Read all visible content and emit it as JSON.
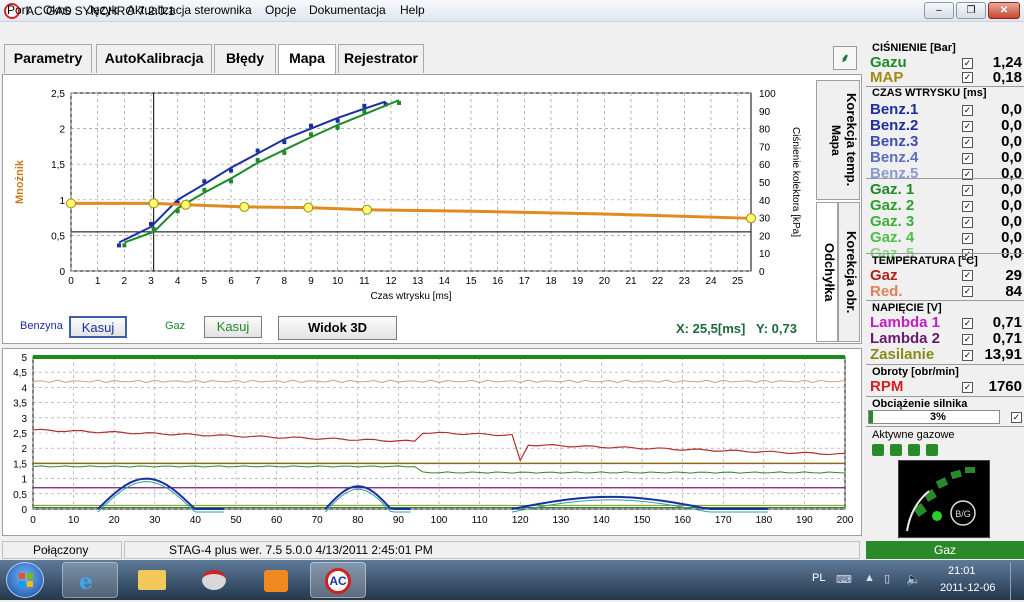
{
  "window": {
    "title": "AC GAS SYNCHRO  7.2.0.1"
  },
  "menu": [
    "Port",
    "Okno",
    "Język",
    "Aktualizacja sterownika",
    "Opcje",
    "Dokumentacja",
    "Help"
  ],
  "tabs": [
    "Parametry",
    "AutoKalibracja",
    "Błędy",
    "Mapa",
    "Rejestrator"
  ],
  "side_tabs": {
    "mapa": "Mapa",
    "korekcja_temp": "Korekcja temp.",
    "odchylka": "Odchyłka",
    "korekcja_obr": "Korekcja obr."
  },
  "map_controls": {
    "benzyna_label": "Benzyna",
    "kasuj": "Kasuj",
    "gaz_label": "Gaz",
    "widok3d": "Widok 3D",
    "coord_x": "X: 25,5[ms]",
    "coord_y": "Y: 0,73"
  },
  "colors": {
    "benzyna": "#1c2fa0",
    "gaz": "#1f8a2a",
    "multiplier": "#e08a20",
    "petrol_line": "#b03030",
    "status_ok": "#2a8a2a"
  },
  "chart_data": [
    {
      "type": "line",
      "xlabel": "Czas wtrysku [ms]",
      "ylabel": "Mnożnik",
      "y2label": "Ciśnienie kolektora [kPa]",
      "xlim": [
        0,
        25.5
      ],
      "ylim": [
        0,
        2.5
      ],
      "y2lim": [
        0,
        100
      ],
      "x_ticks": [
        0,
        1,
        2,
        3,
        4,
        5,
        6,
        7,
        8,
        9,
        10,
        11,
        12,
        13,
        14,
        15,
        16,
        17,
        18,
        19,
        20,
        21,
        22,
        23,
        24,
        25
      ],
      "y_ticks": [
        "0",
        "0,5",
        "1",
        "1,5",
        "2",
        "2,5"
      ],
      "y2_ticks": [
        0,
        10,
        20,
        30,
        40,
        50,
        60,
        70,
        80,
        90,
        100
      ],
      "grid": true,
      "series": [
        {
          "name": "Benzyna",
          "x": [
            1.8,
            3,
            4,
            5,
            6,
            7,
            8,
            9,
            10,
            11,
            11.8
          ],
          "y": [
            0.4,
            0.62,
            1.0,
            1.22,
            1.45,
            1.65,
            1.85,
            2.0,
            2.15,
            2.28,
            2.38
          ]
        },
        {
          "name": "Gaz",
          "x": [
            2.0,
            3.1,
            4,
            5,
            6,
            7,
            8,
            9,
            10,
            11,
            12.3
          ],
          "y": [
            0.4,
            0.55,
            0.88,
            1.1,
            1.3,
            1.52,
            1.7,
            1.88,
            2.05,
            2.2,
            2.4
          ]
        },
        {
          "name": "Mnożnik",
          "x": [
            0,
            3.1,
            4.3,
            6.5,
            8.9,
            11.1,
            15,
            20,
            25.5
          ],
          "y": [
            0.95,
            0.95,
            0.93,
            0.9,
            0.89,
            0.86,
            0.84,
            0.8,
            0.74
          ],
          "points": [
            [
              0,
              0.95
            ],
            [
              3.1,
              0.95
            ],
            [
              4.3,
              0.93
            ],
            [
              6.5,
              0.9
            ],
            [
              8.9,
              0.89
            ],
            [
              11.1,
              0.86
            ],
            [
              25.5,
              0.74
            ]
          ]
        }
      ],
      "hline": 0.55,
      "vline": 3.1
    },
    {
      "type": "line",
      "xlim": [
        0,
        200
      ],
      "ylim": [
        0,
        5
      ],
      "x_ticks": [
        0,
        10,
        20,
        30,
        40,
        50,
        60,
        70,
        80,
        90,
        100,
        110,
        120,
        130,
        140,
        150,
        160,
        170,
        180,
        190,
        200
      ],
      "y_ticks": [
        "0",
        "0,5",
        "1",
        "1,5",
        "2",
        "2,5",
        "3",
        "3,5",
        "4",
        "4,5",
        "5"
      ],
      "grid": true
    }
  ],
  "status": {
    "connection": "Połączony",
    "device": "STAG-4 plus   wer. 7.5  5.0.0     4/13/2011 2:45:01 PM",
    "mode": "Gaz"
  },
  "right_panel": {
    "pressure_title": "CIŚNIENIE [Bar]",
    "gazu_label": "Gazu",
    "gazu_value": "1,24",
    "map_label": "MAP",
    "map_value": "0,18",
    "injection_title": "CZAS WTRYSKU  [ms]",
    "benz": [
      {
        "label": "Benz.1",
        "value": "0,0"
      },
      {
        "label": "Benz.2",
        "value": "0,0"
      },
      {
        "label": "Benz.3",
        "value": "0,0"
      },
      {
        "label": "Benz.4",
        "value": "0,0"
      },
      {
        "label": "Benz.5",
        "value": "0,0"
      }
    ],
    "gaz": [
      {
        "label": "Gaz. 1",
        "value": "0,0"
      },
      {
        "label": "Gaz. 2",
        "value": "0,0"
      },
      {
        "label": "Gaz. 3",
        "value": "0,0"
      },
      {
        "label": "Gaz. 4",
        "value": "0,0"
      },
      {
        "label": "Gaz. 5",
        "value": "0,0"
      }
    ],
    "temp_title": "TEMPERATURA  [°C]",
    "temp_gaz_label": "Gaz",
    "temp_gaz_value": "29",
    "temp_red_label": "Red.",
    "temp_red_value": "84",
    "voltage_title": "NAPIĘCIE [V]",
    "lambda1_label": "Lambda 1",
    "lambda1_value": "0,71",
    "lambda2_label": "Lambda 2",
    "lambda2_value": "0,71",
    "zasilanie_label": "Zasilanie",
    "zasilanie_value": "13,91",
    "rpm_title": "Obroty [obr/min]",
    "rpm_label": "RPM",
    "rpm_value": "1760",
    "load_title": "Obciążenie silnika",
    "load_value": "3%",
    "active_title": "Aktywne gazowe",
    "switch_label": "B/G"
  },
  "taskbar": {
    "language": "PL",
    "time": "21:01",
    "date": "2011-12-06"
  }
}
